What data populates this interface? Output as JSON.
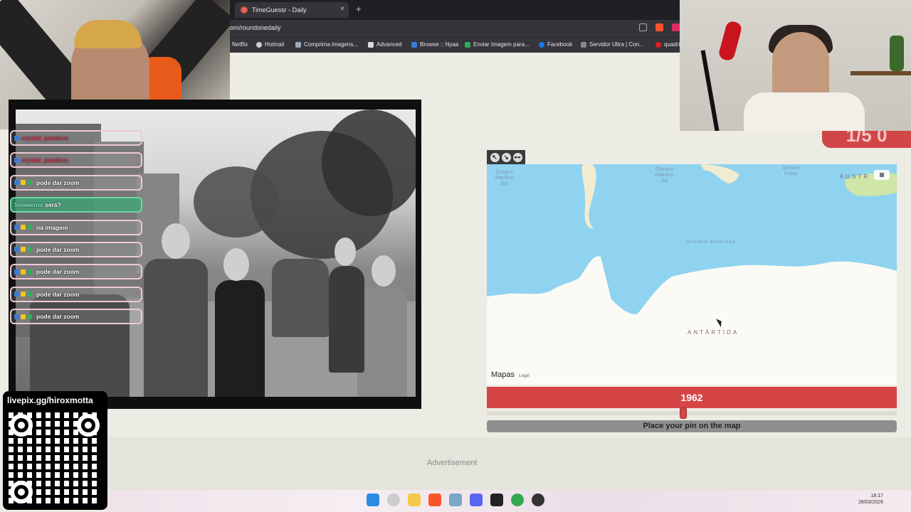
{
  "browser": {
    "tab_title": "TimeGuessr - Daily",
    "tab_close": "×",
    "new_tab": "+",
    "url": "om/roundonedaily",
    "bookmarks": [
      {
        "label": "Netflix",
        "icon_color": "#e50914"
      },
      {
        "label": "Hotmail",
        "icon_color": "#cccccc"
      },
      {
        "label": "Comprima imagens...",
        "icon_color": "#9ab"
      },
      {
        "label": "Advanced",
        "icon_color": "#ddd"
      },
      {
        "label": "Browse :: Nyaa",
        "icon_color": "#3a7bd5"
      },
      {
        "label": "Enviar Imagem para...",
        "icon_color": "#2fae5b"
      },
      {
        "label": "Facebook",
        "icon_color": "#1877f2"
      },
      {
        "label": "Servidor Ultra | Con...",
        "icon_color": "#888"
      },
      {
        "label": "quadri",
        "icon_color": "#e02020"
      }
    ]
  },
  "score": {
    "display": "1/5 0"
  },
  "chat": {
    "messages": [
      {
        "user": "crystal_pandora",
        "text": "",
        "style": "pink"
      },
      {
        "user": "crystal_pandora",
        "text": "",
        "style": "pink"
      },
      {
        "user": "",
        "text": "pode dar zoom",
        "style": "pink"
      },
      {
        "user": "Snowenm",
        "text": "será?",
        "style": "green"
      },
      {
        "user": "",
        "text": "na imagem",
        "style": "pink"
      },
      {
        "user": "",
        "text": "pode dar zoom",
        "style": "pink"
      },
      {
        "user": "",
        "text": "pode dar zoom",
        "style": "pink"
      },
      {
        "user": "",
        "text": "pode dar zoom",
        "style": "pink"
      },
      {
        "user": "",
        "text": "pode dar zoom",
        "style": "pink"
      }
    ]
  },
  "qr": {
    "title": "livepix.gg/hiroxmotta"
  },
  "map": {
    "tools": [
      "↖",
      "↘",
      "⊷"
    ],
    "labels": {
      "ocean_pacific": "Oceano\nPacífico\nSul",
      "ocean_atlantic": "Oceano\nAtlântico\nSul",
      "ocean_indian": "Oceano\nÍndico",
      "ocean_antarctic": "Oceano Antártico",
      "antarctica": "ANTÁRTIDA",
      "australia": "AUSTR"
    },
    "type_icon": "map-icon",
    "attribution": "Mapas",
    "legal": "Legal"
  },
  "year": {
    "value": "1962",
    "slider_fraction": 0.48
  },
  "pin_button": {
    "label": "Place your pin on the map"
  },
  "ad": {
    "label": "Advertisement"
  },
  "taskbar": {
    "icons": [
      "windows-icon",
      "search-icon",
      "folder-icon",
      "brave-icon",
      "files-icon",
      "discord-icon",
      "terminal-icon",
      "chrome-icon",
      "obs-icon"
    ],
    "time": "18:17",
    "date": "28/03/2026"
  },
  "colors": {
    "accent_red": "#d64545",
    "ocean": "#8fd3f0",
    "land": "#fbfaf4",
    "page_bg": "#ecebe4"
  }
}
